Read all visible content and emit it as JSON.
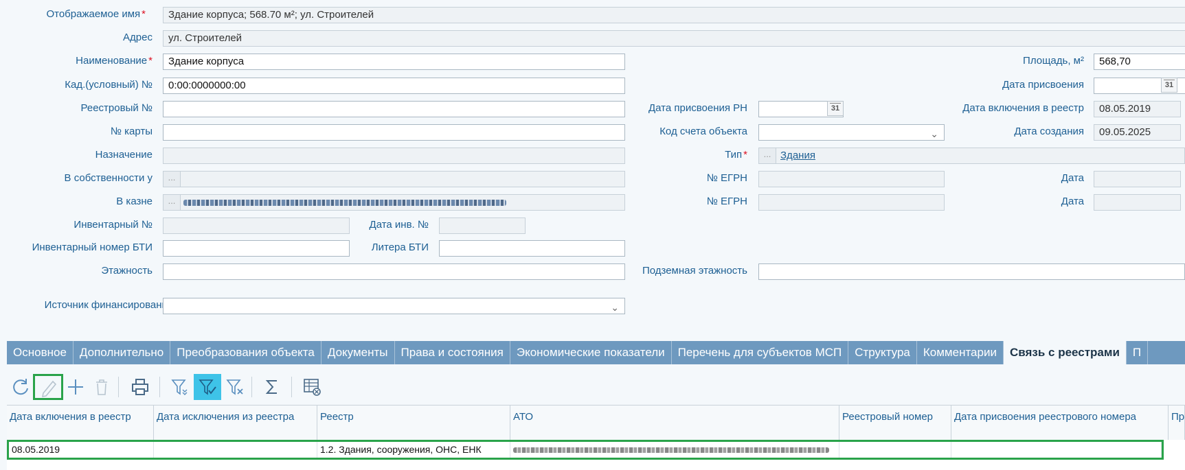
{
  "form": {
    "display_name": {
      "label": "Отображаемое имя",
      "value": "Здание корпуса; 568.70 м²; ул. Строителей"
    },
    "address": {
      "label": "Адрес",
      "value": "ул. Строителей"
    },
    "name": {
      "label": "Наименование",
      "value": "Здание корпуса"
    },
    "area": {
      "label": "Площадь, м²",
      "value": "568,70"
    },
    "cadastral": {
      "label": "Кад.(условный) №",
      "value": "0:00:0000000:00"
    },
    "assign_date": {
      "label": "Дата присвоения",
      "value": ""
    },
    "registry_no": {
      "label": "Реестровый №",
      "value": ""
    },
    "rn_assign_date": {
      "label": "Дата присвоения РН",
      "value": ""
    },
    "registry_include_date": {
      "label": "Дата включения в реестр",
      "value": "08.05.2019"
    },
    "card_no": {
      "label": "№ карты",
      "value": ""
    },
    "account_code": {
      "label": "Код счета объекта",
      "value": ""
    },
    "created_date": {
      "label": "Дата создания",
      "value": "09.05.2025"
    },
    "purpose": {
      "label": "Назначение",
      "value": ""
    },
    "type": {
      "label": "Тип",
      "value": "Здания"
    },
    "owned_by": {
      "label": "В собственности у",
      "value": ""
    },
    "egrn1": {
      "label": "№ ЕГРН",
      "value": ""
    },
    "date1": {
      "label": "Дата",
      "value": ""
    },
    "treasury": {
      "label": "В казне",
      "value": ""
    },
    "egrn2": {
      "label": "№ ЕГРН",
      "value": ""
    },
    "date2": {
      "label": "Дата",
      "value": ""
    },
    "inventory_no": {
      "label": "Инвентарный №",
      "value": ""
    },
    "inventory_date": {
      "label": "Дата инв. №",
      "value": ""
    },
    "bti_inventory": {
      "label": "Инвентарный номер БТИ",
      "value": ""
    },
    "bti_letter": {
      "label": "Литера БТИ",
      "value": ""
    },
    "floors": {
      "label": "Этажность",
      "value": ""
    },
    "underground_floors": {
      "label": "Подземная этажность",
      "value": ""
    },
    "financing_source": {
      "label": "Источник финансирования",
      "value": ""
    },
    "calendar_icon_text": "31"
  },
  "tabs": [
    "Основное",
    "Дополнительно",
    "Преобразования объекта",
    "Документы",
    "Права и состояния",
    "Экономические показатели",
    "Перечень для субъектов МСП",
    "Структура",
    "Комментарии",
    "Связь с реестрами",
    "П"
  ],
  "toolbar": [
    "refresh-icon",
    "edit-icon",
    "add-icon",
    "delete-icon",
    "print-icon",
    "filter-icon",
    "filter-apply-icon",
    "filter-clear-icon",
    "sum-icon",
    "table-settings-icon"
  ],
  "grid": {
    "headers": [
      "Дата включения в реестр",
      "Дата исключения из реестра",
      "Реестр",
      "АТО",
      "Реестровый номер",
      "Дата присвоения реестрового номера",
      "При"
    ],
    "rows": [
      [
        "08.05.2019",
        "",
        "1.2. Здания, сооружения, ОНС, ЕНК",
        "",
        "",
        ""
      ]
    ]
  },
  "colors": {
    "label": "#1d5f93",
    "tab_bar": "#6e99bf",
    "active_tool": "#3ec3e8",
    "selection": "#2aa34a",
    "required": "#dd1122"
  }
}
